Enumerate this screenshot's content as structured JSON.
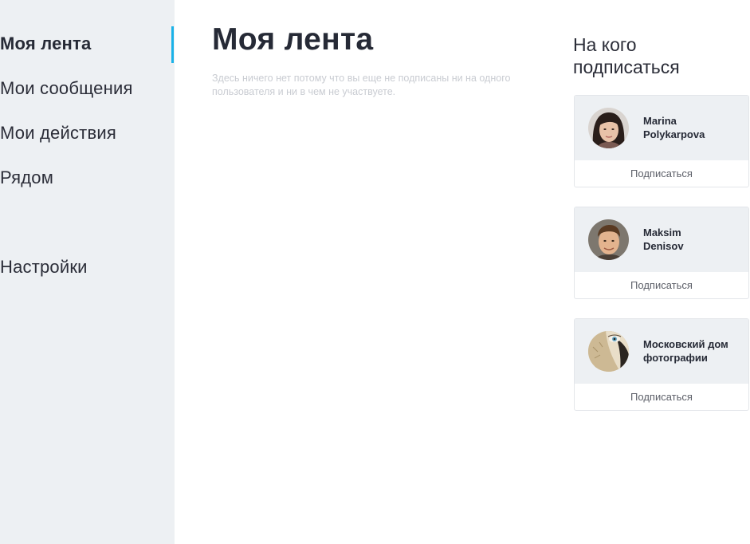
{
  "sidebar": {
    "items": [
      {
        "label": "Моя лента"
      },
      {
        "label": "Мои сообщения"
      },
      {
        "label": "Мои действия"
      },
      {
        "label": "Рядом"
      },
      {
        "label": "Настройки"
      }
    ]
  },
  "main": {
    "title": "Моя лента",
    "empty_text": "Здесь ничего нет потому что вы еще не подписаны ни на одного пользователя и ни в чем не участвуете."
  },
  "suggestions": {
    "title": "На кого подписаться",
    "cards": [
      {
        "name_line1": "Marina",
        "name_line2": "Polykarpova",
        "button": "Подписаться"
      },
      {
        "name_line1": "Maksim",
        "name_line2": "Denisov",
        "button": "Подписаться"
      },
      {
        "name_line1": "Московский дом",
        "name_line2": "фотографии",
        "button": "Подписаться"
      }
    ]
  },
  "colors": {
    "accent": "#1ab2e8",
    "sidebar_bg": "#edf0f3",
    "text_dark": "#262a36",
    "text_muted": "#c9ccd2"
  },
  "icons": [
    "avatar-marina",
    "avatar-maksim",
    "avatar-moscow-photo-house"
  ]
}
